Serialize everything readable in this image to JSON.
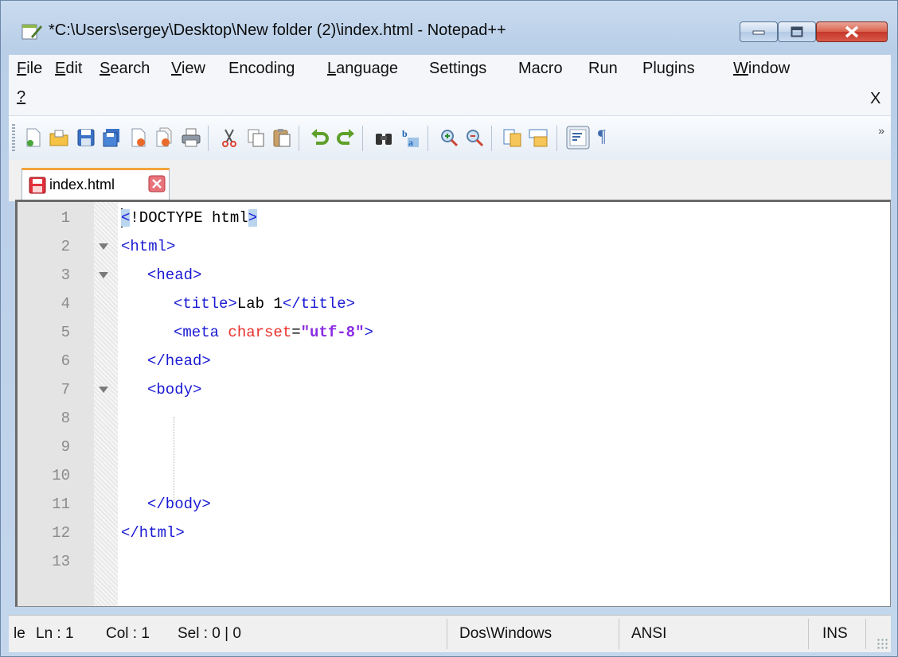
{
  "window": {
    "title": "*C:\\Users\\sergey\\Desktop\\New folder (2)\\index.html - Notepad++",
    "min_icon": "minimize-icon",
    "max_icon": "maximize-icon",
    "close_icon": "close-icon"
  },
  "menu": {
    "items": [
      {
        "first": "F",
        "rest": "ile"
      },
      {
        "first": "E",
        "rest": "dit"
      },
      {
        "first": "S",
        "rest": "earch"
      },
      {
        "first": "V",
        "rest": "iew"
      },
      {
        "first": "",
        "rest": "Encoding"
      },
      {
        "first": "L",
        "rest": "anguage"
      },
      {
        "first": "Se",
        "rest": "ttings"
      },
      {
        "first": "",
        "rest": "Macro"
      },
      {
        "first": "",
        "rest": "Run"
      },
      {
        "first": "",
        "rest": "Plugins"
      },
      {
        "first": "W",
        "rest": "indow"
      }
    ],
    "help": "?",
    "close_doc": "X"
  },
  "toolbar": {
    "icons": [
      "new-file-icon",
      "open-file-icon",
      "save-icon",
      "save-all-icon",
      "close-icon",
      "close-all-icon",
      "print-icon",
      "cut-icon",
      "copy-icon",
      "paste-icon",
      "undo-icon",
      "redo-icon",
      "find-icon",
      "replace-icon",
      "zoom-in-icon",
      "zoom-out-icon",
      "sync-vertical-icon",
      "sync-horizontal-icon",
      "word-wrap-icon",
      "show-all-chars-icon"
    ],
    "more": "»",
    "pilcrow": "¶"
  },
  "tab": {
    "label": "index.html"
  },
  "editor": {
    "lines": [
      {
        "n": "1"
      },
      {
        "n": "2"
      },
      {
        "n": "3"
      },
      {
        "n": "4"
      },
      {
        "n": "5"
      },
      {
        "n": "6"
      },
      {
        "n": "7"
      },
      {
        "n": "8"
      },
      {
        "n": "9"
      },
      {
        "n": "10"
      },
      {
        "n": "11"
      },
      {
        "n": "12"
      },
      {
        "n": "13"
      }
    ],
    "tokens": {
      "l1_open": "<",
      "l1_body": "!DOCTYPE html",
      "l1_close": ">",
      "l2": "<html>",
      "l3": "<head>",
      "l4_open": "<title>",
      "l4_text": "Lab 1",
      "l4_close": "</title>",
      "l5_open": "<meta ",
      "l5_attr": "charset",
      "l5_eq": "=",
      "l5_val": "\"utf-8\"",
      "l5_close": ">",
      "l6": "</head>",
      "l7": "<body>",
      "l11": "</body>",
      "l12": "</html>"
    }
  },
  "status": {
    "mode": "le",
    "ln": "Ln : 1",
    "col": "Col : 1",
    "sel": "Sel : 0 | 0",
    "eol": "Dos\\Windows",
    "encoding": "ANSI",
    "ins": "INS"
  }
}
